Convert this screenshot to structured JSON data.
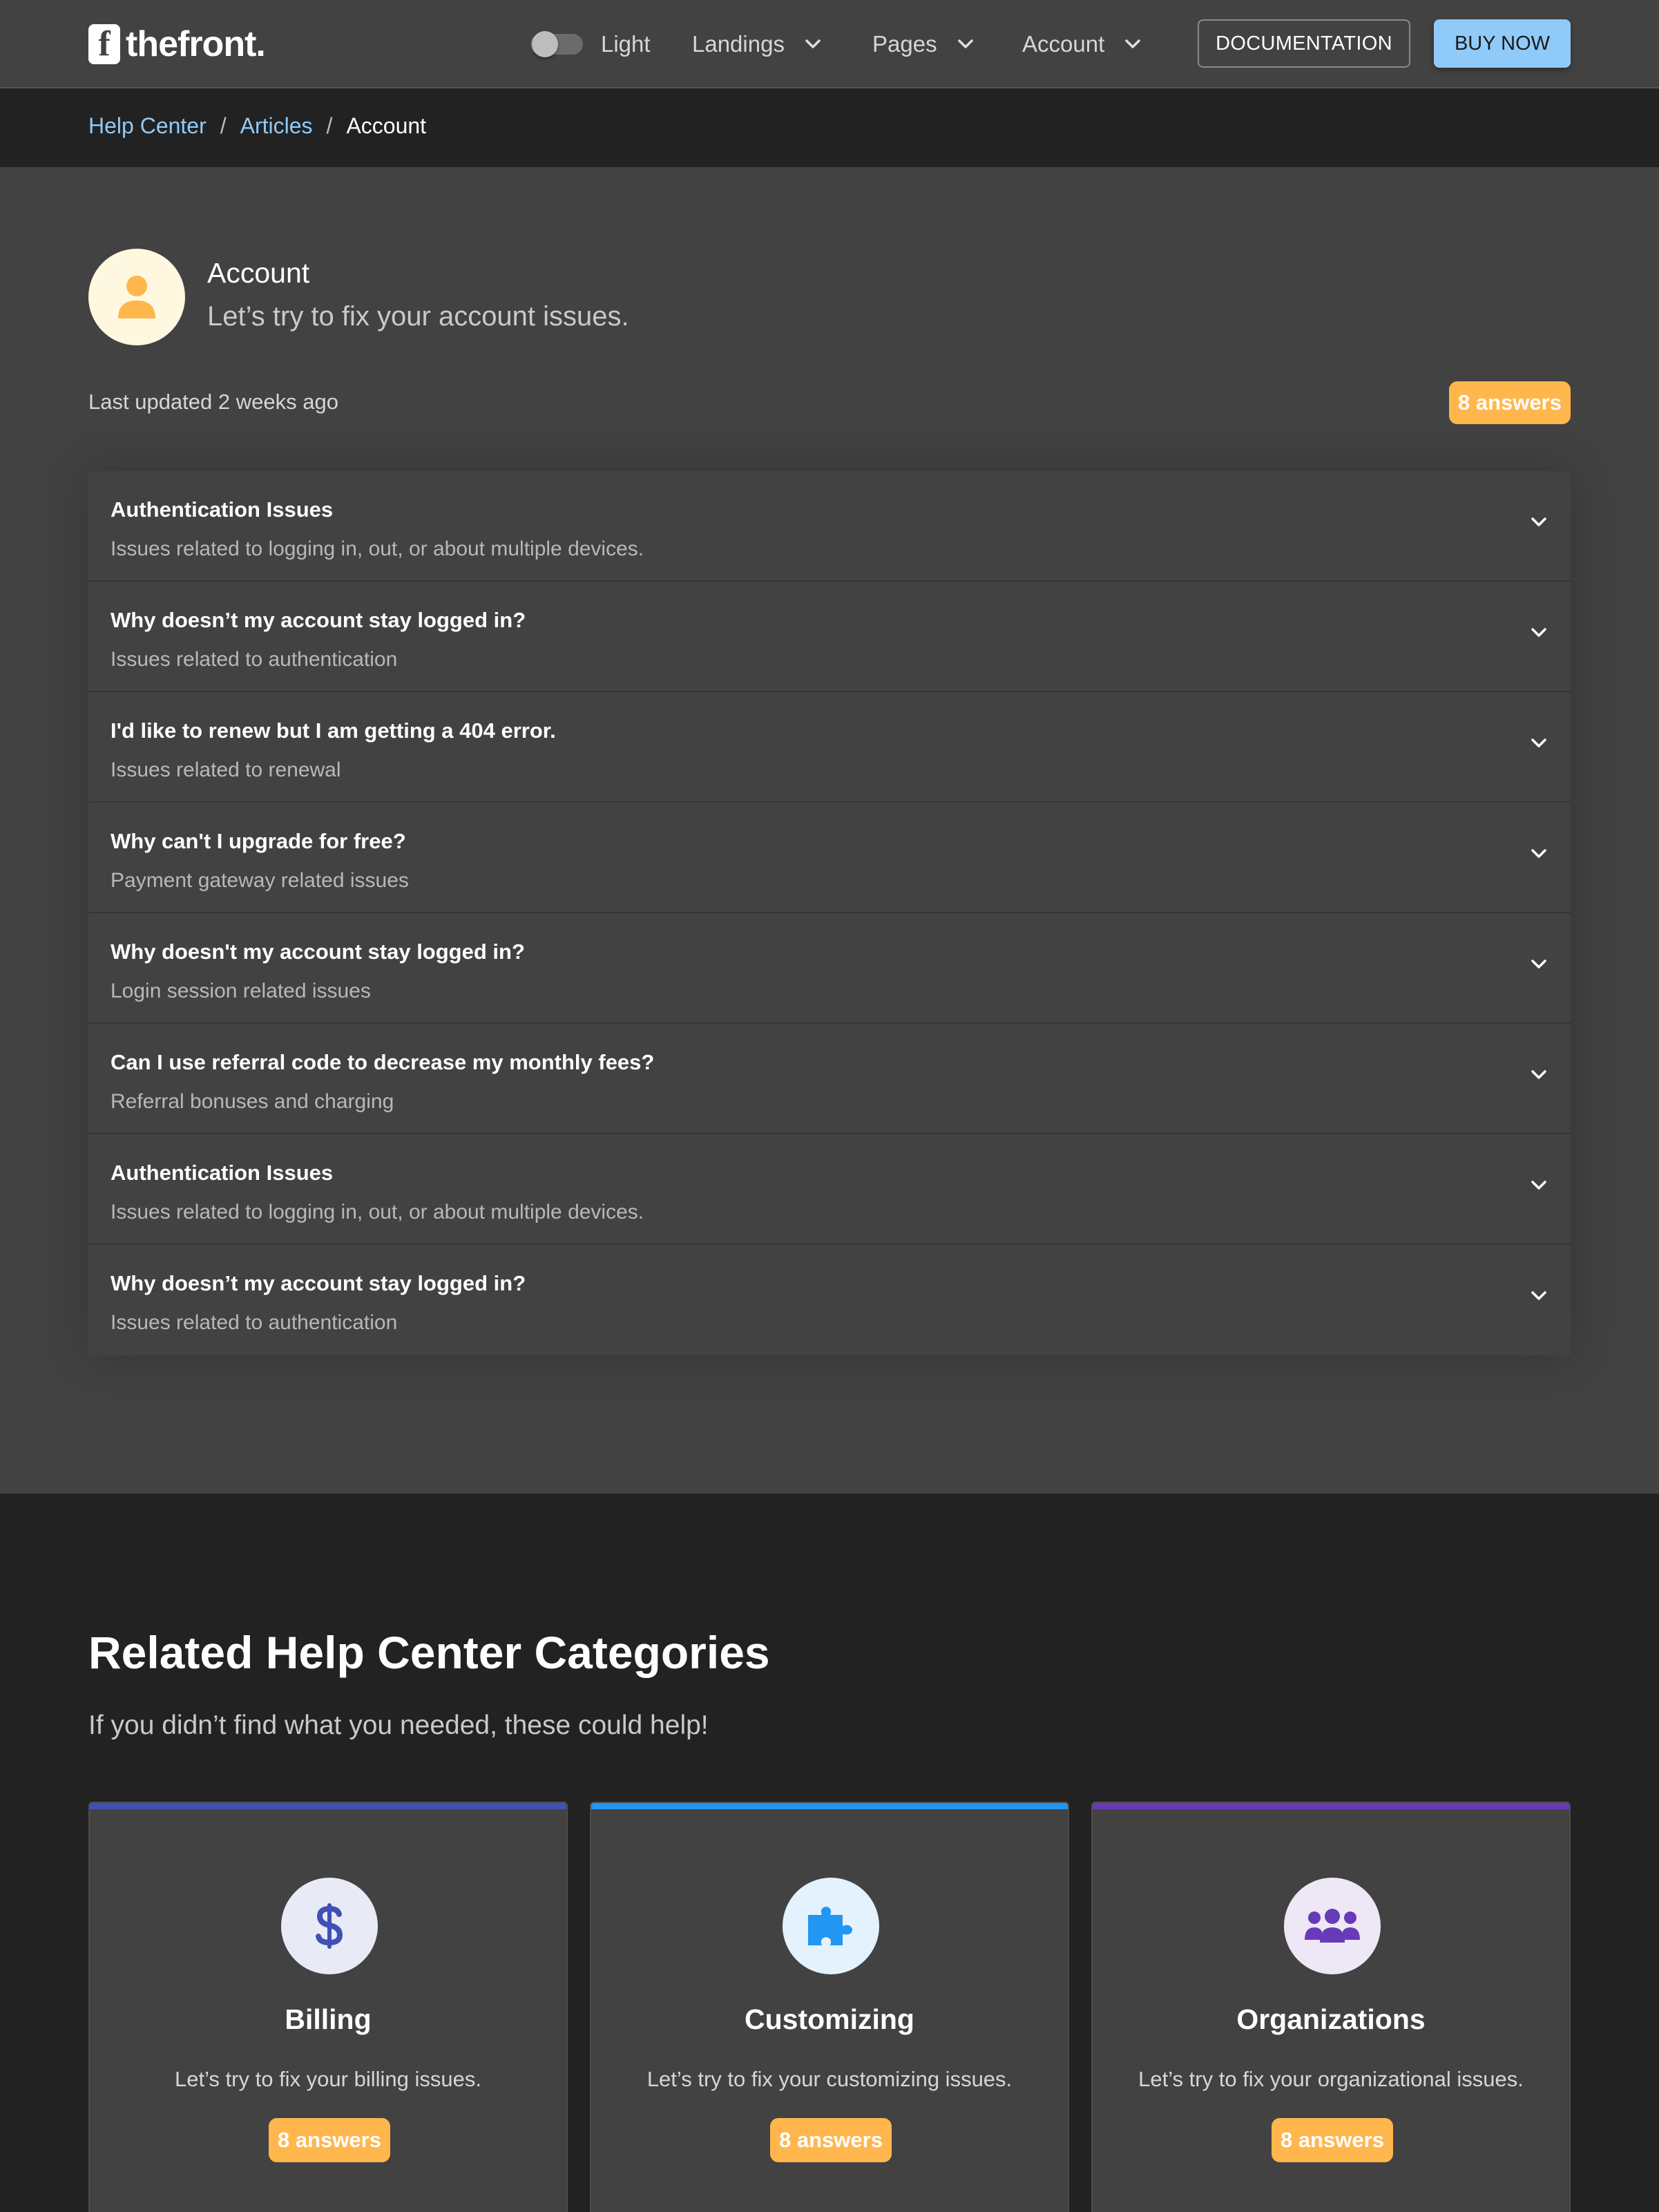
{
  "header": {
    "logo_mark": "f",
    "logo_text": "thefront.",
    "theme_label": "Light",
    "nav": [
      {
        "label": "Landings"
      },
      {
        "label": "Pages"
      },
      {
        "label": "Account"
      }
    ],
    "documentation_label": "DOCUMENTATION",
    "buy_label": "BUY NOW"
  },
  "breadcrumb": {
    "items": [
      "Help Center",
      "Articles"
    ],
    "separator": "/",
    "current": "Account"
  },
  "topic": {
    "icon": "user-icon",
    "title": "Account",
    "subtitle": "Let’s try to fix your account issues.",
    "last_updated": "Last updated 2 weeks ago",
    "answers": "8 answers"
  },
  "faq": [
    {
      "question": "Authentication Issues",
      "subtitle": "Issues related to logging in, out, or about multiple devices."
    },
    {
      "question": "Why doesn’t my account stay logged in?",
      "subtitle": "Issues related to authentication"
    },
    {
      "question": "I'd like to renew but I am getting a 404 error.",
      "subtitle": "Issues related to renewal"
    },
    {
      "question": "Why can't I upgrade for free?",
      "subtitle": "Payment gateway related issues"
    },
    {
      "question": "Why doesn't my account stay logged in?",
      "subtitle": "Login session related issues"
    },
    {
      "question": "Can I use referral code to decrease my monthly fees?",
      "subtitle": "Referral bonuses and charging"
    },
    {
      "question": "Authentication Issues",
      "subtitle": "Issues related to logging in, out, or about multiple devices."
    },
    {
      "question": "Why doesn’t my account stay logged in?",
      "subtitle": "Issues related to authentication"
    }
  ],
  "related": {
    "title": "Related Help Center Categories",
    "subtitle": "If you didn’t find what you needed, these could help!",
    "cards": [
      {
        "icon": "dollar-icon",
        "title": "Billing",
        "description": "Let’s try to fix your billing issues.",
        "answers": "8 answers",
        "accent": "#3f51b5"
      },
      {
        "icon": "puzzle-icon",
        "title": "Customizing",
        "description": "Let’s try to fix your customizing issues.",
        "answers": "8 answers",
        "accent": "#2196f3"
      },
      {
        "icon": "group-icon",
        "title": "Organizations",
        "description": "Let’s try to fix your organizational issues.",
        "answers": "8 answers",
        "accent": "#673ab7"
      }
    ]
  },
  "colors": {
    "header_bg": "#424242",
    "page_bg": "#222222",
    "link": "#90caf9",
    "badge": "#ffb74d",
    "primary_button": "#90caf9"
  }
}
